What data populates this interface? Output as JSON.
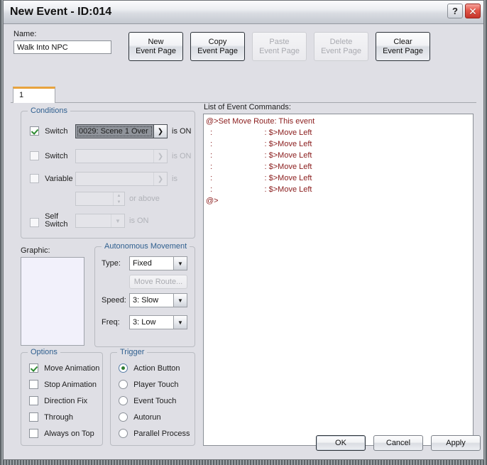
{
  "window": {
    "title": "New Event - ID:014",
    "help_button": "?",
    "close_button": "✕"
  },
  "form": {
    "name_label": "Name:",
    "name_value": "Walk Into NPC",
    "page_buttons": [
      {
        "line1": "New",
        "line2": "Event Page",
        "enabled": true
      },
      {
        "line1": "Copy",
        "line2": "Event Page",
        "enabled": true
      },
      {
        "line1": "Paste",
        "line2": "Event Page",
        "enabled": false
      },
      {
        "line1": "Delete",
        "line2": "Event Page",
        "enabled": false
      },
      {
        "line1": "Clear",
        "line2": "Event Page",
        "enabled": true
      }
    ],
    "tabs": [
      {
        "label": "1",
        "selected": true
      }
    ]
  },
  "conditions": {
    "legend": "Conditions",
    "switch1": {
      "checkbox_label": "Switch",
      "checked": true,
      "value": "0029: Scene 1 Over",
      "browse_arrow": "❯",
      "suffix": "is ON"
    },
    "switch2": {
      "checkbox_label": "Switch",
      "checked": false,
      "value": "",
      "browse_arrow": "❯",
      "suffix": "is ON"
    },
    "variable": {
      "checkbox_label": "Variable",
      "checked": false,
      "value": "",
      "browse_arrow": "❯",
      "suffix": "is",
      "spin_value": "",
      "spin_suffix": "or above"
    },
    "self_switch": {
      "checkbox_label_line1": "Self",
      "checkbox_label_line2": "Switch",
      "checked": false,
      "value": "",
      "suffix": "is ON"
    }
  },
  "graphic": {
    "label": "Graphic:"
  },
  "autonomous_movement": {
    "legend": "Autonomous Movement",
    "type_label": "Type:",
    "type_value": "Fixed",
    "move_route_label": "Move Route...",
    "move_route_enabled": false,
    "speed_label": "Speed:",
    "speed_value": "3: Slow",
    "freq_label": "Freq:",
    "freq_value": "3: Low"
  },
  "options": {
    "legend": "Options",
    "items": [
      {
        "label": "Move Animation",
        "checked": true
      },
      {
        "label": "Stop Animation",
        "checked": false
      },
      {
        "label": "Direction Fix",
        "checked": false
      },
      {
        "label": "Through",
        "checked": false
      },
      {
        "label": "Always on Top",
        "checked": false
      }
    ]
  },
  "trigger": {
    "legend": "Trigger",
    "items": [
      {
        "label": "Action Button",
        "selected": true
      },
      {
        "label": "Player Touch",
        "selected": false
      },
      {
        "label": "Event Touch",
        "selected": false
      },
      {
        "label": "Autorun",
        "selected": false
      },
      {
        "label": "Parallel Process",
        "selected": false
      }
    ]
  },
  "event_commands": {
    "label": "List of Event Commands:",
    "lines": [
      "@>Set Move Route: This event",
      "  :                        : $>Move Left",
      "  :                        : $>Move Left",
      "  :                        : $>Move Left",
      "  :                        : $>Move Left",
      "  :                        : $>Move Left",
      "  :                        : $>Move Left",
      "@>"
    ]
  },
  "footer": {
    "ok": "OK",
    "cancel": "Cancel",
    "apply": "Apply"
  },
  "colors": {
    "dialog_background": "#dfdfe5",
    "group_legend": "#2f5f8f",
    "command_text": "#8a1c1c",
    "tab_accent": "#e8a33d",
    "check_green": "#2e8b32",
    "close_red": "#c5342a",
    "graphic_box": "#f2f1fb"
  }
}
